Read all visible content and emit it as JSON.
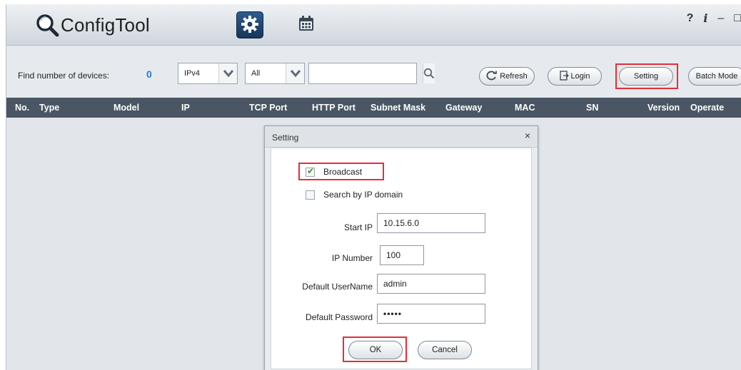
{
  "app": {
    "title": "ConfigTool"
  },
  "titlebar": {
    "tabs": [
      {
        "name": "settings",
        "icon": "gear-icon",
        "active": true
      },
      {
        "name": "calendar",
        "icon": "calendar-icon",
        "active": false
      }
    ],
    "controls": {
      "help": "?",
      "info": "i",
      "minimize": "–",
      "maximize": "□"
    }
  },
  "toolbar": {
    "find_label": "Find number of devices:",
    "find_count": "0",
    "ip_select": "IPv4",
    "filter_select": "All",
    "search_value": "",
    "refresh_label": "Refresh",
    "login_label": "Login",
    "setting_label": "Setting",
    "batch_label": "Batch Mode"
  },
  "table": {
    "columns": [
      "No.",
      "Type",
      "Model",
      "IP",
      "TCP Port",
      "HTTP Port",
      "Subnet Mask",
      "Gateway",
      "MAC",
      "SN",
      "Version",
      "Operate"
    ],
    "rows": []
  },
  "dialog": {
    "title": "Setting",
    "close": "×",
    "broadcast_label": "Broadcast",
    "broadcast_checked": true,
    "ipdomain_label": "Search by IP domain",
    "ipdomain_checked": false,
    "start_ip_label": "Start IP",
    "start_ip_value": "10.15.6.0",
    "ip_number_label": "IP Number",
    "ip_number_value": "100",
    "username_label": "Default UserName",
    "username_value": "admin",
    "password_label": "Default Password",
    "password_value": "•••••",
    "ok_label": "OK",
    "cancel_label": "Cancel"
  },
  "colors": {
    "accent": "#1e7fd6",
    "header_bg": "#4a5663",
    "highlight": "#e0303a",
    "active_tab": "#1f426b"
  }
}
